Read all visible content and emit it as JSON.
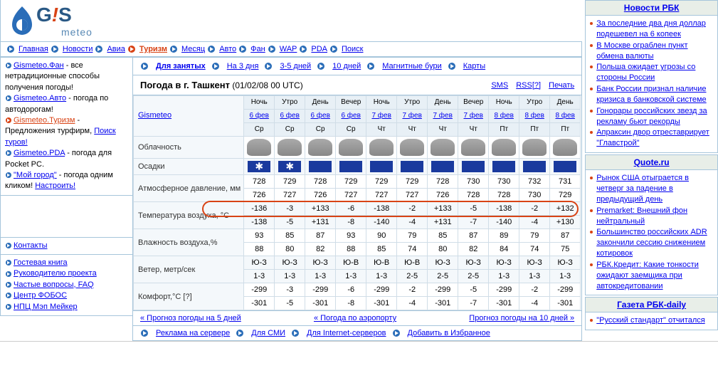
{
  "logo": {
    "brand_g": "G",
    "brand_excl": "!",
    "brand_s": "S",
    "brand_sub": "meteo"
  },
  "nav": {
    "main": [
      "Главная",
      "Новости",
      "Авиа",
      "Туризм",
      "Месяц",
      "Авто",
      "Фан",
      "WAP",
      "PDA",
      "Поиск"
    ],
    "active": "Туризм",
    "sub": [
      {
        "label": "Для занятых",
        "bold": true
      },
      {
        "label": "На 3 дня"
      },
      {
        "label": "3-5 дней"
      },
      {
        "label": "10 дней"
      },
      {
        "label": "Магнитные бури"
      },
      {
        "label": "Карты"
      }
    ]
  },
  "title": {
    "city": "Погода в г. Ташкент",
    "date": "(01/02/08 00 UTC)",
    "links": [
      "SMS",
      "RSS[?]",
      "Печать"
    ]
  },
  "left": {
    "promo": [
      {
        "link": "Gismeteo.Фан",
        "text": " - все нетрадиционные способы получения погоды!"
      },
      {
        "link": "Gismeteo.Авто",
        "text": " - погода по автодорогам!"
      },
      {
        "link": "Gismeteo.Туризм",
        "red": true,
        "text": " - Предложения турфирм, ",
        "tail": "Поиск туров!"
      },
      {
        "link": "Gismeteo.PDA",
        "text": " - погода для Pocket PC."
      },
      {
        "link": "\"Мой город\"",
        "text": " - погода одним кликом! ",
        "tail": "Настроить!"
      }
    ],
    "contacts_head": "Контакты",
    "contacts": [
      "Гостевая книга",
      "Руководителю проекта",
      "Частые вопросы, FAQ",
      "Центр ФОБОС",
      "НПЦ Мэп Мейкер"
    ]
  },
  "forecast": {
    "gismeteo": "Gismeteo",
    "times": [
      "Ночь",
      "Утро",
      "День",
      "Вечер",
      "Ночь",
      "Утро",
      "День",
      "Вечер",
      "Ночь",
      "Утро",
      "День"
    ],
    "dates": [
      "6 фев",
      "6 фев",
      "6 фев",
      "6 фев",
      "7 фев",
      "7 фев",
      "7 фев",
      "7 фев",
      "8 фев",
      "8 фев",
      "8 фев"
    ],
    "days": [
      "Ср",
      "Ср",
      "Ср",
      "Ср",
      "Чт",
      "Чт",
      "Чт",
      "Чт",
      "Пт",
      "Пт",
      "Пт"
    ],
    "rows": {
      "cloud": "Облачность",
      "precip": "Осадки",
      "pressure": "Атмосферное давление, мм",
      "temp": "Температура воздуха, °C",
      "humidity": "Влажность воздуха,%",
      "wind": "Ветер, метр/сек",
      "comfort": "Комфорт,°C [?]"
    },
    "precip_type": [
      "snow",
      "snow",
      "blue",
      "blue",
      "blue",
      "blue",
      "blue",
      "blue",
      "blue",
      "blue",
      "blue"
    ],
    "pressure": [
      [
        "728",
        "729",
        "728",
        "729",
        "729",
        "729",
        "728",
        "730",
        "730",
        "732",
        "731"
      ],
      [
        "726",
        "727",
        "726",
        "727",
        "727",
        "727",
        "726",
        "728",
        "728",
        "730",
        "729"
      ]
    ],
    "temp": [
      [
        "-136",
        "-3",
        "+133",
        "-6",
        "-138",
        "-2",
        "+133",
        "-5",
        "-138",
        "-2",
        "+132"
      ],
      [
        "-138",
        "-5",
        "+131",
        "-8",
        "-140",
        "-4",
        "+131",
        "-7",
        "-140",
        "-4",
        "+130"
      ]
    ],
    "humidity": [
      [
        "93",
        "85",
        "87",
        "93",
        "90",
        "79",
        "85",
        "87",
        "89",
        "79",
        "87"
      ],
      [
        "88",
        "80",
        "82",
        "88",
        "85",
        "74",
        "80",
        "82",
        "84",
        "74",
        "75"
      ]
    ],
    "wind_dir": [
      "Ю-З",
      "Ю-З",
      "Ю-З",
      "Ю-В",
      "Ю-В",
      "Ю-В",
      "Ю-З",
      "Ю-З",
      "Ю-З",
      "Ю-З",
      "Ю-З"
    ],
    "wind_val": [
      "1-3",
      "1-3",
      "1-3",
      "1-3",
      "1-3",
      "2-5",
      "2-5",
      "2-5",
      "1-3",
      "1-3",
      "1-3"
    ],
    "comfort": [
      [
        "-299",
        "-3",
        "-299",
        "-6",
        "-299",
        "-2",
        "-299",
        "-5",
        "-299",
        "-2",
        "-299"
      ],
      [
        "-301",
        "-5",
        "-301",
        "-8",
        "-301",
        "-4",
        "-301",
        "-7",
        "-301",
        "-4",
        "-301"
      ]
    ],
    "footer": [
      "« Прогноз погоды на 5 дней",
      "« Погода по аэропорту",
      "Прогноз погоды на 10 дней »"
    ],
    "ads": [
      "Реклама на сервере",
      "Для СМИ",
      "Для Internet-серверов",
      "Добавить в Избранное"
    ]
  },
  "news": {
    "rbc_head": "Новости РБК",
    "rbc": [
      "За последние два дня доллар подешевел на 6 копеек",
      "В Москве ограблен пункт обмена валюты",
      "Польша ожидает угрозы со стороны России",
      "Банк России признал наличие кризиса в банковской системе",
      "Гонорары российских звезд за рекламу бьют рекорды",
      "Апраксин двор отреставрирует \"Главстрой\""
    ],
    "quote_head": "Quote.ru",
    "quote": [
      "Рынок США отыграется в четверг за падение в предыдущий день",
      "Premarket: Внешний фон нейтральный",
      "Большинство российских ADR закончили сессию снижением котировок",
      "РБК.Кредит: Какие тонкости ожидают заемщика при автокредитовании"
    ],
    "daily_head": "Газета РБК-daily",
    "daily": [
      "\"Русский стандарт\" отчитался"
    ]
  }
}
